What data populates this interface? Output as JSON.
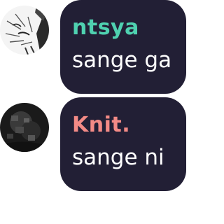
{
  "messages": [
    {
      "author": "ntsya",
      "author_color": "#4fd1b0",
      "text": "sange ga",
      "avatar": "anime-sketch-avatar"
    },
    {
      "author": "Knit.",
      "author_color": "#f38a86",
      "text": "sange ni",
      "avatar": "dark-photo-avatar"
    }
  ],
  "colors": {
    "bubble_background": "#221f35",
    "message_text": "#ffffff",
    "page_background": "#ffffff"
  }
}
